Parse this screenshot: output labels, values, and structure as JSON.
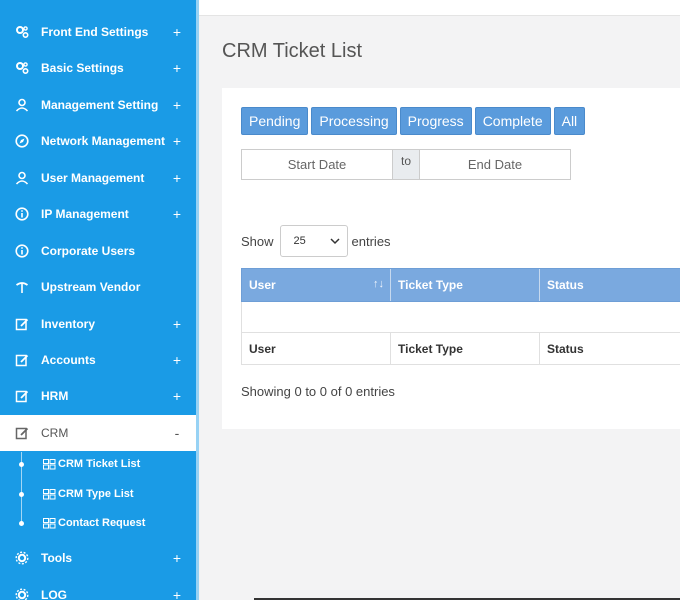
{
  "sidebar": {
    "items": [
      {
        "label": "Front End Settings",
        "icon": "gears-icon",
        "toggle": "+"
      },
      {
        "label": "Basic Settings",
        "icon": "gears-icon",
        "toggle": "+"
      },
      {
        "label": "Management Setting",
        "icon": "user-icon",
        "toggle": "+"
      },
      {
        "label": "Network Management",
        "icon": "compass-icon",
        "toggle": "+"
      },
      {
        "label": "User Management",
        "icon": "user-icon",
        "toggle": "+"
      },
      {
        "label": "IP Management",
        "icon": "info-icon",
        "toggle": "+"
      },
      {
        "label": "Corporate Users",
        "icon": "info-icon",
        "toggle": ""
      },
      {
        "label": "Upstream Vendor",
        "icon": "signpost-icon",
        "toggle": ""
      },
      {
        "label": "Inventory",
        "icon": "edit-icon",
        "toggle": "+"
      },
      {
        "label": "Accounts",
        "icon": "edit-icon",
        "toggle": "+"
      },
      {
        "label": "HRM",
        "icon": "edit-icon",
        "toggle": "+"
      },
      {
        "label": "CRM",
        "icon": "edit-icon",
        "toggle": "-"
      },
      {
        "label": "Tools",
        "icon": "gear-icon",
        "toggle": "+"
      },
      {
        "label": "LOG",
        "icon": "gear-icon",
        "toggle": "+"
      }
    ],
    "sub_items": [
      {
        "label": "CRM Ticket List"
      },
      {
        "label": "CRM Type List"
      },
      {
        "label": "Contact Request"
      }
    ],
    "active": "CRM"
  },
  "page": {
    "title": "CRM Ticket List"
  },
  "filters": {
    "buttons": [
      "Pending",
      "Processing",
      "Progress",
      "Complete",
      "All"
    ],
    "start_date_placeholder": "Start Date",
    "to_label": "to",
    "end_date_placeholder": "End Date"
  },
  "length": {
    "show_label": "Show",
    "value": "25",
    "entries_label": "entries"
  },
  "table": {
    "columns": [
      "User",
      "Ticket Type",
      "Status"
    ],
    "footer": [
      "User",
      "Ticket Type",
      "Status"
    ],
    "rows": []
  },
  "info": "Showing 0 to 0 of 0 entries",
  "colors": {
    "sidebar": "#1a9be6",
    "button": "#5a9bdc",
    "table_header": "#7aa9df"
  }
}
